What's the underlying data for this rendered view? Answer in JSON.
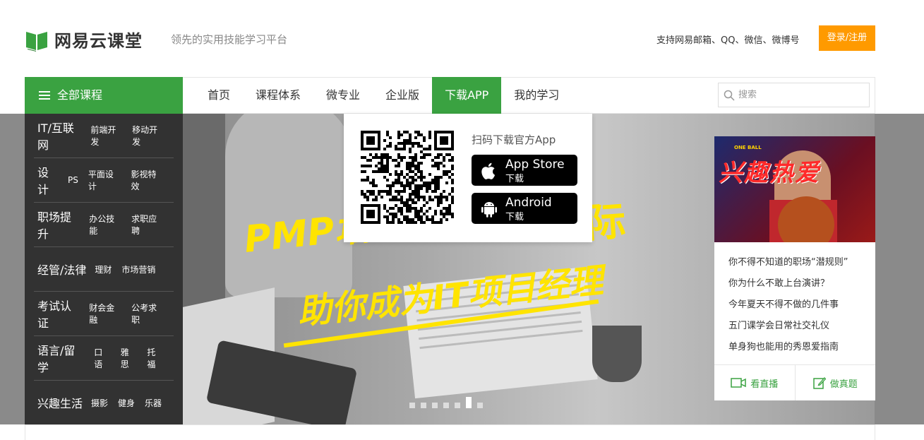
{
  "header": {
    "logo_text": "网易云课堂",
    "slogan": "领先的实用技能学习平台",
    "support_text": "支持网易邮箱、QQ、微信、微博号",
    "login_label": "登录/注册",
    "accent_color": "#3aa241",
    "login_color": "#ff9a00"
  },
  "nav": {
    "all_courses": "全部课程",
    "items": [
      "首页",
      "课程体系",
      "微专业",
      "企业版",
      "下载APP",
      "我的学习"
    ],
    "active": "下载APP",
    "search_placeholder": "搜索"
  },
  "sidebar": {
    "categories": [
      {
        "main": "IT/互联网",
        "subs": [
          "前端开发",
          "移动开发"
        ]
      },
      {
        "main": "设计",
        "subs": [
          "PS",
          "平面设计",
          "影视特效"
        ]
      },
      {
        "main": "职场提升",
        "subs": [
          "办公技能",
          "求职应聘"
        ]
      },
      {
        "main": "经管/法律",
        "subs": [
          "理财",
          "市场营销"
        ]
      },
      {
        "main": "考试认证",
        "subs": [
          "财会金融",
          "公考求职"
        ]
      },
      {
        "main": "语言/留学",
        "subs": [
          "口语",
          "雅思",
          "托福"
        ]
      },
      {
        "main": "兴趣生活",
        "subs": [
          "摄影",
          "健身",
          "乐器"
        ]
      }
    ]
  },
  "download_dropdown": {
    "scan_text": "扫码下载官方App",
    "appstore": {
      "line1": "App Store",
      "line2": "下载"
    },
    "android": {
      "line1": "Android",
      "line2": "下载"
    }
  },
  "hero": {
    "line1": "PMP培训",
    "line1b": "际",
    "line2": "助你成为IT项目经理",
    "slides": 7,
    "active_slide": 6
  },
  "right_panel": {
    "banner_title": "兴趣热爱",
    "banner_tag": "ONE BALL",
    "links": [
      "你不得不知道的职场“潜规则”",
      "你为什么不敢上台演讲？",
      "今年夏天不得不做的几件事",
      "五门课学会日常社交礼仪",
      "单身狗也能用的秀恩爱指南"
    ],
    "btn_live": "看直播",
    "btn_exam": "做真题"
  }
}
